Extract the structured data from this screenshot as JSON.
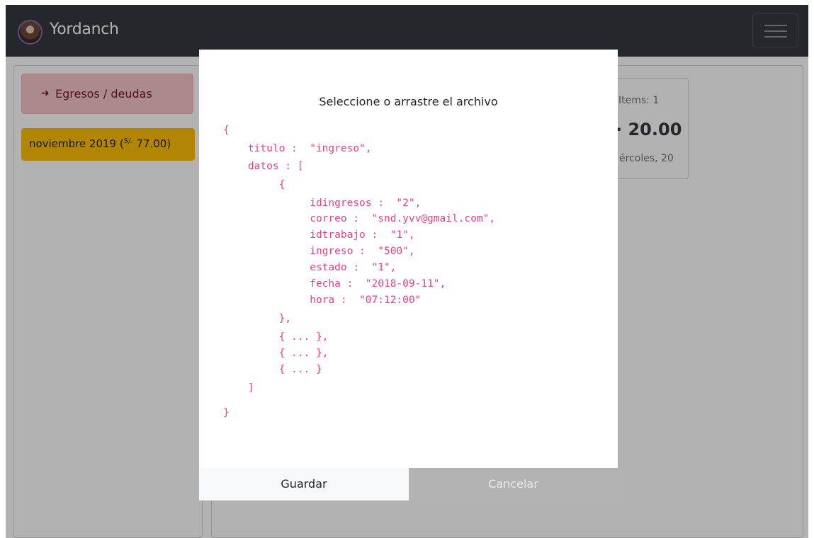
{
  "navbar": {
    "brand": "Yordanch",
    "toggler_icon": "hamburger-menu-icon"
  },
  "sidebar": {
    "egresos_icon": "sign-out-icon",
    "egresos_label": "Egresos / deudas",
    "month": {
      "label_pre": "noviembre 2019 (",
      "currency": "S/.",
      "amount": " 77.00)"
    }
  },
  "summary": {
    "items": "Items: 1",
    "amount": "· 20.00",
    "date": "ércoles, 20"
  },
  "modal": {
    "title": "Seleccione o arrastre el archivo",
    "json_lines": [
      "{",
      "    titulo :  \"ingreso\",",
      "    datos : [",
      "         {",
      "              idingresos :  \"2\",",
      "              correo :  \"snd.yvv@gmail.com\",",
      "              idtrabajo :  \"1\",",
      "              ingreso :  \"500\",",
      "              estado :  \"1\",",
      "              fecha :  \"2018-09-11\",",
      "              hora :  \"07:12:00\"",
      "         },",
      "         { ... },",
      "         { ... },",
      "         { ... }",
      "    ]",
      "}"
    ],
    "save_label": "Guardar",
    "cancel_label": "Cancelar"
  },
  "colors": {
    "navbar": "#343a40",
    "danger_light": "#f5c6cb",
    "warning": "#ffc107",
    "code_pink": "#e83e8c",
    "cancel_gray": "#b3b3b3"
  }
}
